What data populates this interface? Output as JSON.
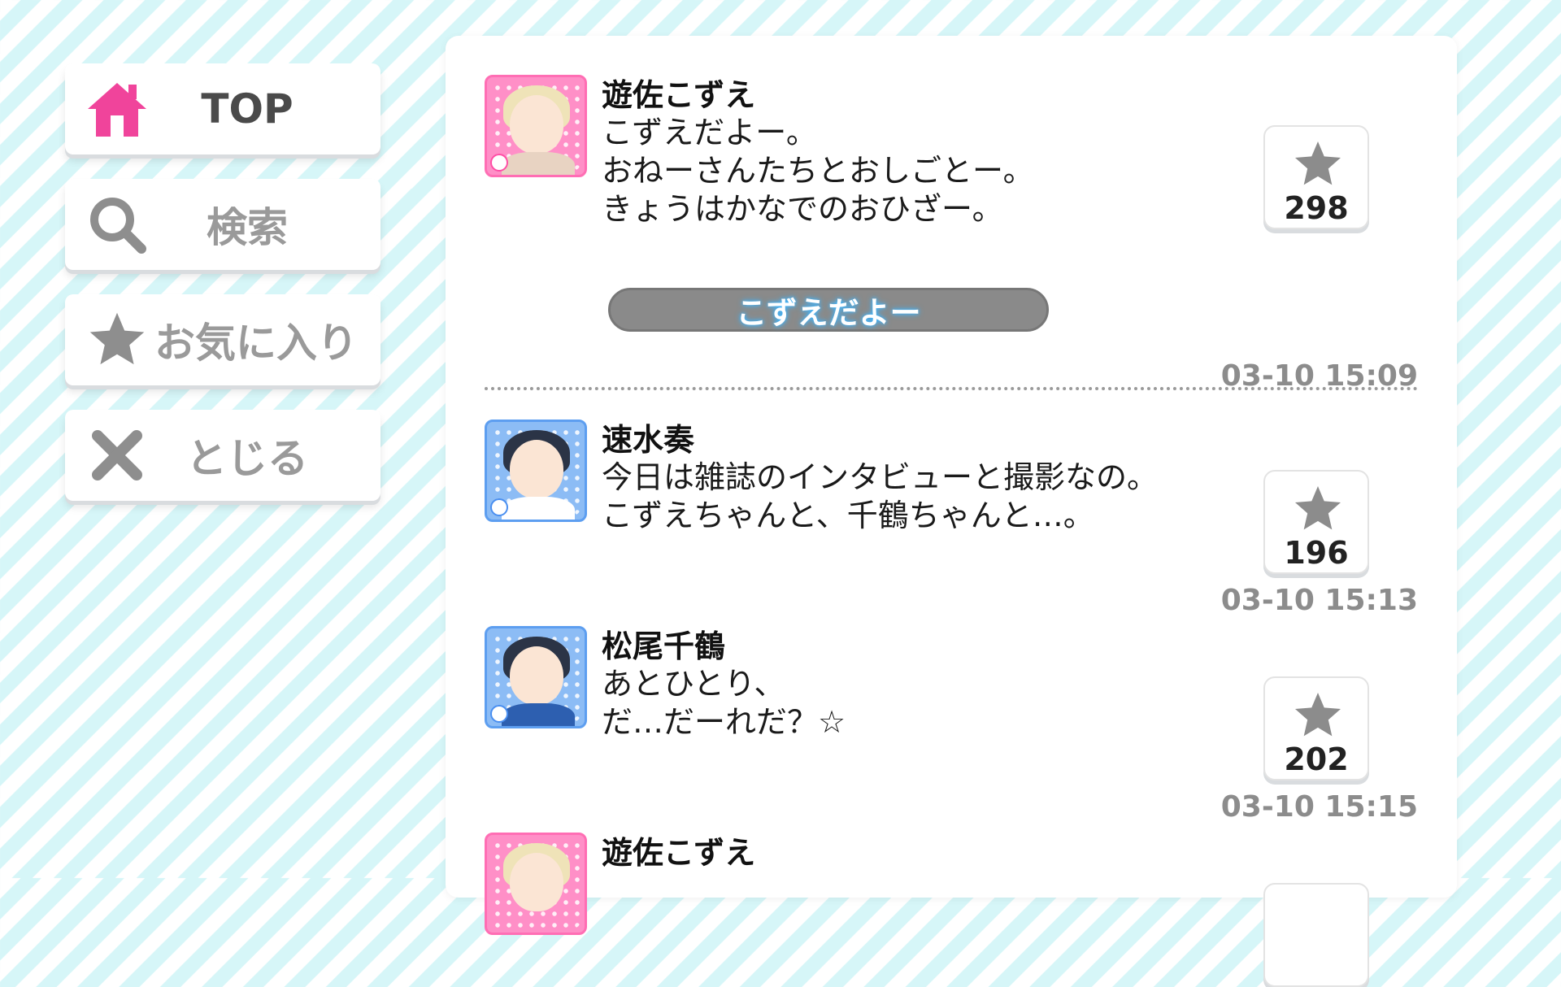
{
  "sidebar": {
    "top_label": "TOP",
    "search_label": "検索",
    "favorites_label": "お気に入り",
    "close_label": "とじる"
  },
  "posts": [
    {
      "name": "遊佐こずえ",
      "text": "こずえだよー。\nおねーさんたちとおしごとー。\nきょうはかなでのおひざー。",
      "voice_label": "こずえだよー",
      "likes": "298",
      "time": "03-10 15:09"
    },
    {
      "name": "速水奏",
      "text": "今日は雑誌のインタビューと撮影なの。\nこずえちゃんと、千鶴ちゃんと…。",
      "likes": "196",
      "time": "03-10 15:13"
    },
    {
      "name": "松尾千鶴",
      "text": "あとひとり、\nだ…だーれだ？☆",
      "likes": "202",
      "time": "03-10 15:15"
    },
    {
      "name": "遊佐こずえ"
    }
  ],
  "colors": {
    "home_icon": "#f0449b",
    "grey_icon": "#8e8e8e",
    "star_icon": "#8c8c8c"
  }
}
